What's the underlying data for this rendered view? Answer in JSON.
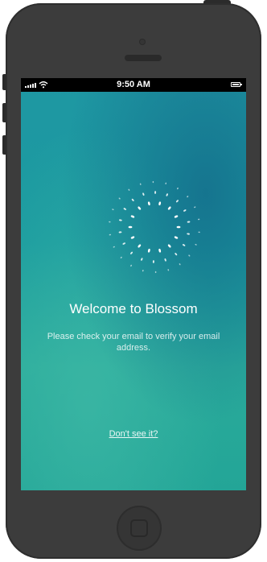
{
  "status_bar": {
    "time": "9:50 AM",
    "signal_icon": "signal-bars-icon",
    "wifi_icon": "wifi-icon",
    "battery_icon": "battery-icon"
  },
  "screen": {
    "spinner_icon": "dotted-ring-loader-icon",
    "title": "Welcome to Blossom",
    "message": "Please check your email to verify your email address.",
    "link_label": "Don't see it?"
  },
  "colors": {
    "background_top": "#1f97a3",
    "background_bottom": "#23a597",
    "phone_body": "#3c3c3c",
    "text": "#ffffff"
  }
}
